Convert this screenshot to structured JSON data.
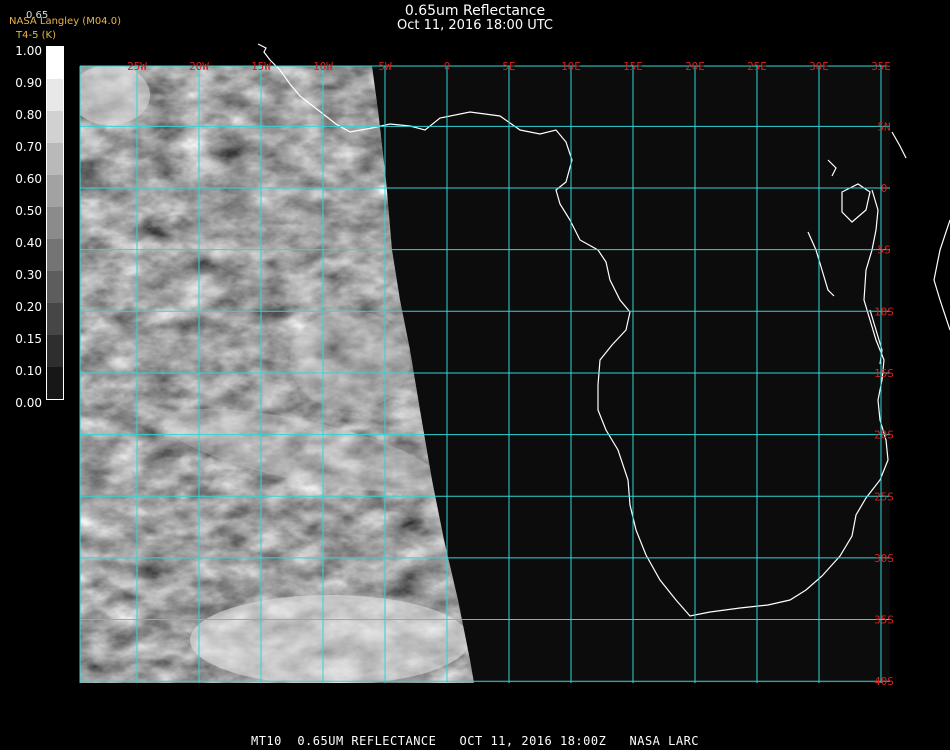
{
  "header": {
    "title": "0.65um Reflectance",
    "datetime": "Oct 11, 2016 18:00 UTC",
    "producer": "NASA Langley (M04.0)",
    "units": "T4-5 (K)",
    "top_value": "0.65"
  },
  "colorbar": {
    "labels": [
      "1.00",
      "0.90",
      "0.80",
      "0.70",
      "0.60",
      "0.50",
      "0.40",
      "0.30",
      "0.20",
      "0.15",
      "0.10",
      "0.00"
    ],
    "values": [
      1.0,
      0.9,
      0.8,
      0.7,
      0.6,
      0.5,
      0.4,
      0.3,
      0.2,
      0.15,
      0.1,
      0.0
    ]
  },
  "grid": {
    "lon_labels": [
      "25W",
      "20W",
      "15W",
      "10W",
      "5W",
      "0",
      "5E",
      "10E",
      "15E",
      "20E",
      "25E",
      "30E",
      "35E"
    ],
    "lon_values": [
      -25,
      -20,
      -15,
      -10,
      -5,
      0,
      5,
      10,
      15,
      20,
      25,
      30,
      35
    ],
    "lat_labels": [
      "5N",
      "0",
      "5S",
      "10S",
      "15S",
      "20S",
      "25S",
      "30S",
      "35S",
      "40S"
    ],
    "lat_values": [
      5,
      0,
      -5,
      -10,
      -15,
      -20,
      -25,
      -30,
      -35,
      -40
    ],
    "line_color": "#2fd6d6",
    "label_color": "#d42020"
  },
  "footer": {
    "text": "MT10  0.65UM REFLECTANCE   OCT 11, 2016 18:00Z   NASA LARC"
  }
}
